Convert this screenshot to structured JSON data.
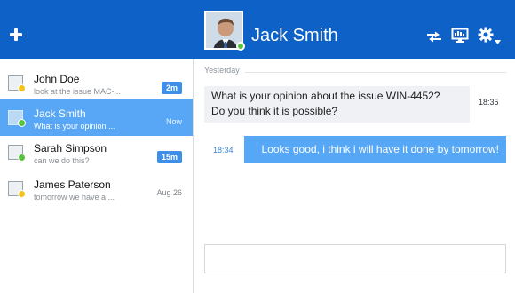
{
  "header": {
    "contact_name": "Jack Smith",
    "status": "online",
    "brand_color": "#0e62c7",
    "icons": [
      "plus-icon",
      "swap-icon",
      "screen-share-icon",
      "gear-icon",
      "caret-down-icon"
    ]
  },
  "sidebar": {
    "conversations": [
      {
        "name": "John Doe",
        "preview": "look at the issue MAC-...",
        "time": "2m",
        "time_style": "badge",
        "status_color": "#f0c419",
        "active": false
      },
      {
        "name": "Jack Smith",
        "preview": "What is your opinion ...",
        "time": "Now",
        "time_style": "plain",
        "status_color": "#58c23e",
        "active": true
      },
      {
        "name": "Sarah Simpson",
        "preview": "can we do this?",
        "time": "15m",
        "time_style": "badge",
        "status_color": "#58c23e",
        "active": false
      },
      {
        "name": "James Paterson",
        "preview": "tomorrow we have a ...",
        "time": "Aug 26",
        "time_style": "plain",
        "status_color": "#f0c419",
        "active": false
      }
    ]
  },
  "chat": {
    "day_label": "Yesterday",
    "messages": [
      {
        "direction": "incoming",
        "text": "What is your opinion about the issue WIN-4452?\nDo you think it is possible?",
        "time": "18:35"
      },
      {
        "direction": "outgoing",
        "text": "Looks good, i think i will have it done by tomorrow!",
        "time": "18:34"
      }
    ],
    "composer": {
      "value": "",
      "placeholder": ""
    }
  }
}
